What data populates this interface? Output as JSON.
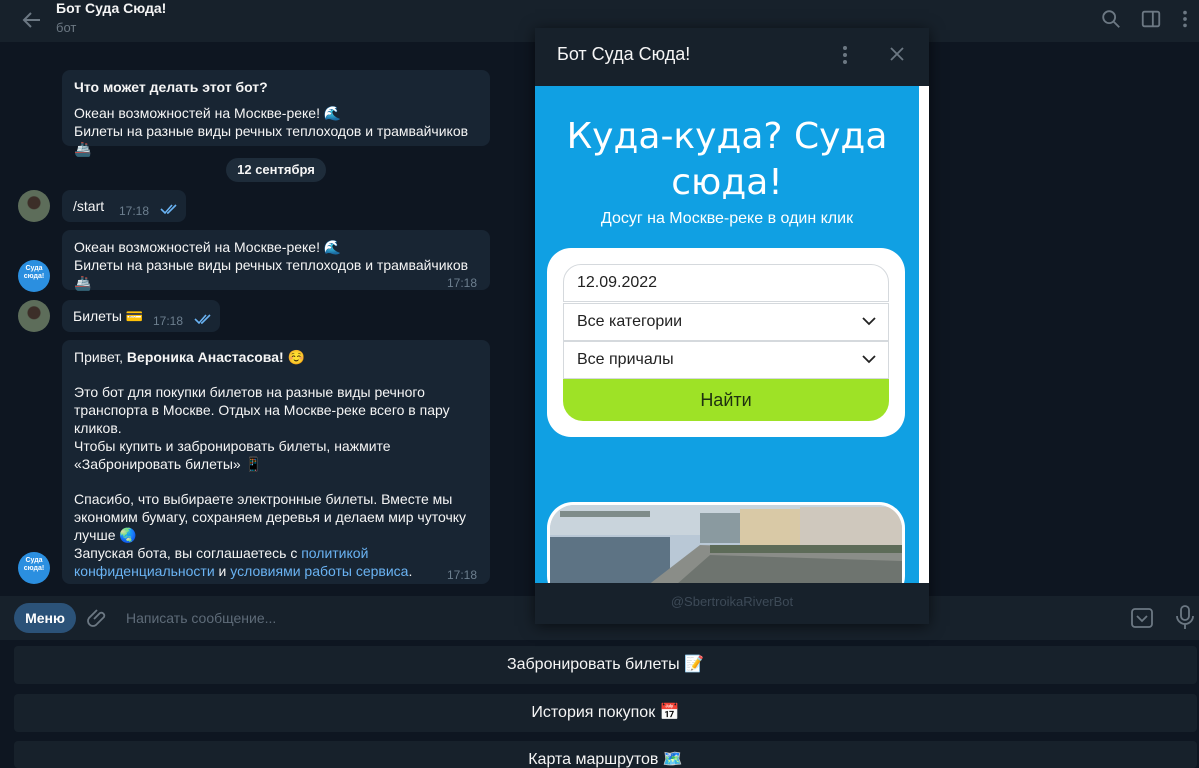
{
  "header": {
    "title": "Бот Суда Сюда!",
    "subtitle": "бот"
  },
  "messages": {
    "intro": {
      "heading": "Что может делать этот бот?",
      "line1": "Океан возможностей на Москве-реке! 🌊",
      "line2": "Билеты на разные виды речных теплоходов и трамвайчиков 🚢"
    },
    "date_separator": "12 сентября",
    "start": {
      "text": "/start",
      "time": "17:18"
    },
    "bot_reply1": {
      "line1": "Океан возможностей на Москве-реке! 🌊",
      "line2": "Билеты на разные виды речных теплоходов и трамвайчиков 🚢",
      "time": "17:18"
    },
    "tickets": {
      "text": "Билеты 💳",
      "time": "17:18"
    },
    "welcome": {
      "greeting_prefix": "Привет, ",
      "user_name": "Вероника Анастасова!",
      "greeting_emoji": " ☺️",
      "para1_l1": "Это бот для покупки билетов на разные виды речного",
      "para1_l2": "транспорта в Москве. Отдых на Москве-реке всего в пару",
      "para1_l3": "кликов.",
      "para1_l4": "Чтобы купить и забронировать билеты, нажмите",
      "para1_l5": "«Забронировать билеты» 📱",
      "para2_l1": "Спасибо, что выбираете электронные билеты. Вместе мы",
      "para2_l2": "экономим бумагу, сохраняем деревья и делаем мир чуточку",
      "para2_l3": "лучше 🌏",
      "para2_l4_prefix": "Запуская бота, вы соглашаетесь с ",
      "link_privacy_a": "политикой",
      "link_privacy_b": "конфиденциальности",
      "and_word": " и ",
      "link_terms": "условиями работы сервиса",
      "period": ".",
      "time": "17:18"
    },
    "bot_avatar_text": "Суда сюда!"
  },
  "composer": {
    "menu_label": "Меню",
    "placeholder": "Написать сообщение..."
  },
  "keyboard": {
    "row1": "Забронировать билеты 📝",
    "row2": "История покупок 📅",
    "row3": "Карта маршрутов 🗺️"
  },
  "popup": {
    "title": "Бот Суда Сюда!",
    "hero_title_l1": "Куда-куда? Суда",
    "hero_title_l2": "сюда!",
    "hero_subtitle": "Досуг на Москве-реке в один клик",
    "date_value": "12.09.2022",
    "category_value": "Все категории",
    "pier_value": "Все причалы",
    "search_label": "Найти",
    "footer": "@SbertroikaRiverBot"
  },
  "colors": {
    "bg": "#0e1621",
    "panel": "#17212b",
    "incoming_bubble": "#182533",
    "outgoing_bubble": "#2b5278",
    "webapp_blue": "#10a0e3",
    "search_green": "#9ee226",
    "link": "#6ab3f3"
  }
}
